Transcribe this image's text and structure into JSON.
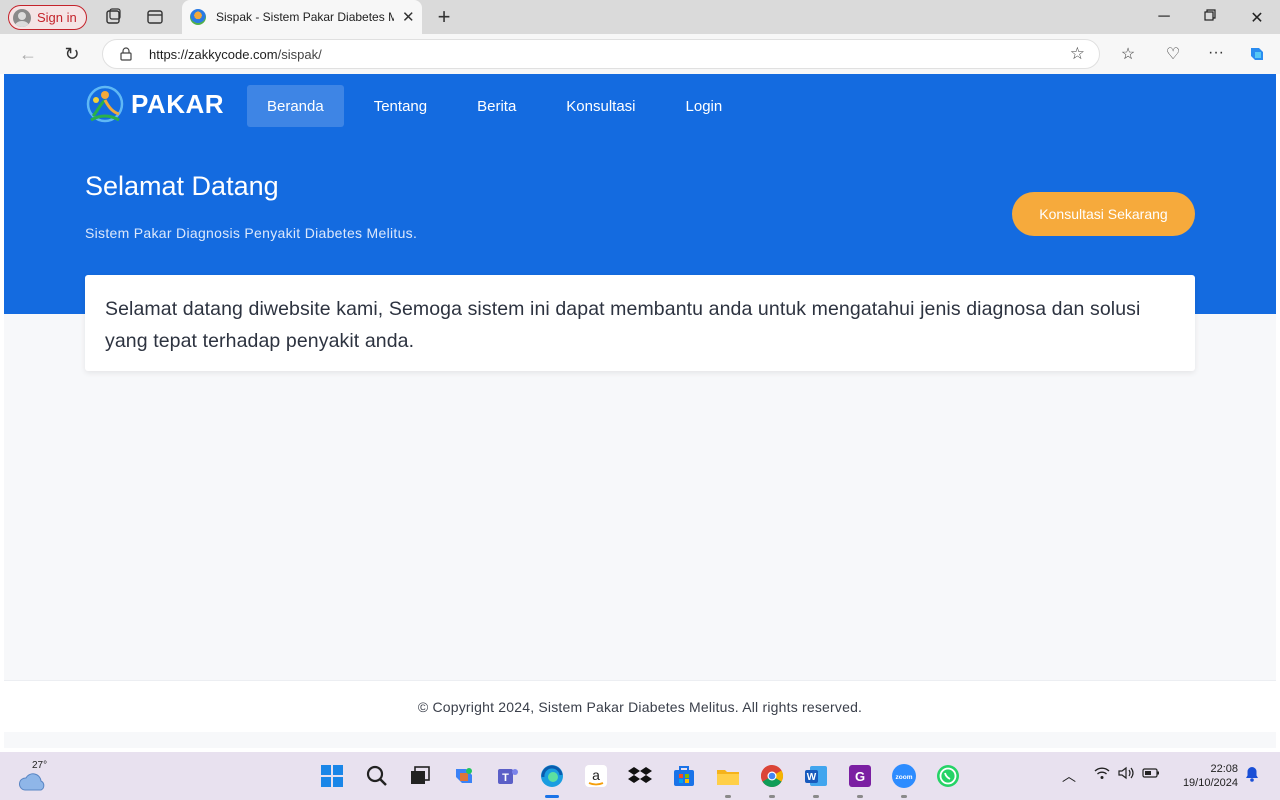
{
  "browser": {
    "sign_in_label": "Sign in",
    "tab_title": "Sispak - Sistem Pakar Diabetes Melitus",
    "url_host": "https://zakkycode.com",
    "url_path": "/sispak/"
  },
  "site": {
    "brand": "PAKAR",
    "nav": [
      {
        "label": "Beranda",
        "active": true
      },
      {
        "label": "Tentang",
        "active": false
      },
      {
        "label": "Berita",
        "active": false
      },
      {
        "label": "Konsultasi",
        "active": false
      },
      {
        "label": "Login",
        "active": false
      }
    ],
    "hero_title": "Selamat Datang",
    "hero_subtitle": "Sistem Pakar Diagnosis Penyakit Diabetes Melitus.",
    "cta_label": "Konsultasi Sekarang",
    "welcome_text": "Selamat datang diwebsite kami, Semoga sistem ini dapat membantu anda untuk mengatahui jenis diagnosa dan solusi yang tepat terhadap penyakit anda.",
    "footer_text": "© Copyright 2024, Sistem Pakar Diabetes Melitus. All rights reserved."
  },
  "taskbar": {
    "temperature": "27°",
    "time": "22:08",
    "date": "19/10/2024",
    "apps": [
      "start-icon",
      "search-icon",
      "task-view-icon",
      "copilot-icon",
      "teams-icon",
      "edge-icon",
      "amazon-icon",
      "dropbox-icon",
      "store-icon",
      "file-explorer-icon",
      "chrome-icon",
      "word-icon",
      "pdf-app-icon",
      "zoom-icon",
      "whatsapp-icon"
    ]
  },
  "colors": {
    "hero_blue": "#146be0",
    "cta_orange": "#f6aa3c",
    "signin_red": "#c4232b"
  }
}
